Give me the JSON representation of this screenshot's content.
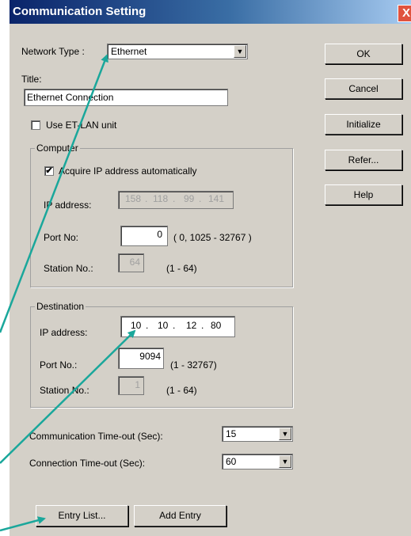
{
  "dialog": {
    "title": "Communication Setting",
    "close_glyph": "X"
  },
  "network_type": {
    "label": "Network Type :",
    "value": "Ethernet"
  },
  "title_field": {
    "label": "Title:",
    "value": "Ethernet Connection"
  },
  "use_et_lan": {
    "label": "Use ET-LAN unit",
    "checked": false
  },
  "computer": {
    "group_title": "Computer",
    "acquire_ip": {
      "label": "Acquire IP address automatically",
      "checked": true,
      "mark": "✔"
    },
    "ip_label": "IP address:",
    "ip": [
      "158",
      "118",
      "99",
      "141"
    ],
    "port_label": "Port No:",
    "port_value": "0",
    "port_range": "( 0, 1025 - 32767 )",
    "station_label": "Station No.:",
    "station_value": "64",
    "station_range": "(1 - 64)"
  },
  "destination": {
    "group_title": "Destination",
    "ip_label": "IP address:",
    "ip": [
      "10",
      "10",
      "12",
      "80"
    ],
    "port_label": "Port No.:",
    "port_value": "9094",
    "port_range": "(1 - 32767)",
    "station_label": "Station No.:",
    "station_value": "1",
    "station_range": "(1 - 64)"
  },
  "comm_timeout": {
    "label": "Communication Time-out (Sec):",
    "value": "15"
  },
  "conn_timeout": {
    "label": "Connection Time-out (Sec):",
    "value": "60"
  },
  "buttons": {
    "ok": "OK",
    "cancel": "Cancel",
    "initialize": "Initialize",
    "refer": "Refer...",
    "help": "Help",
    "entry_list": "Entry List...",
    "add_entry": "Add Entry"
  },
  "ip_separator": ".",
  "colors": {
    "arrow": "#1aa79b",
    "titlebar": "#0a246a",
    "close": "#e0533f"
  }
}
